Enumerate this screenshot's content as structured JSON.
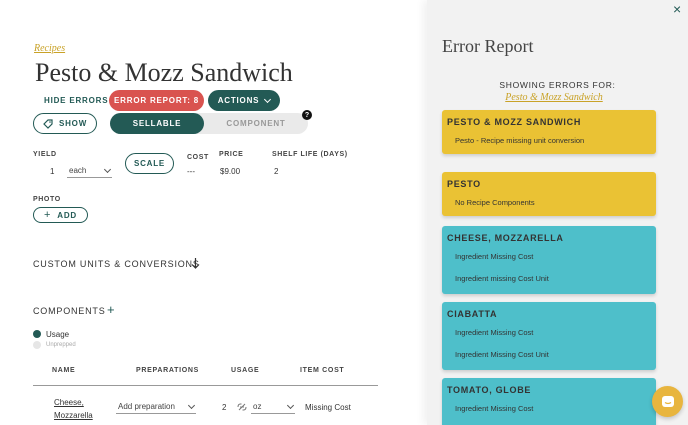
{
  "recipe": {
    "breadcrumb": "Recipes",
    "title": "Pesto & Mozz Sandwich"
  },
  "toolbar": {
    "hide_errors": "HIDE ERRORS",
    "error_report": "ERROR REPORT: 8",
    "actions": "ACTIONS",
    "show": "SHOW",
    "sellable": "SELLABLE",
    "component": "COMPONENT",
    "help": "?"
  },
  "details": {
    "yield_label": "YIELD",
    "yield_value": "1",
    "yield_unit": "each",
    "scale": "SCALE",
    "cost_label": "COST",
    "cost_value": "---",
    "price_label": "PRICE",
    "price_value": "$9.00",
    "shelf_label": "SHELF LIFE (DAYS)",
    "shelf_value": "2",
    "photo_label": "PHOTO",
    "add": "ADD"
  },
  "sections": {
    "custom_units": "CUSTOM UNITS & CONVERSIONS",
    "components": "COMPONENTS"
  },
  "legend": {
    "usage": "Usage",
    "unprepped": "Unprepped"
  },
  "table": {
    "headers": [
      "NAME",
      "PREPARATIONS",
      "USAGE",
      "ITEM COST"
    ],
    "row": {
      "name_line1": "Cheese,",
      "name_line2": "Mozzarella",
      "preparation": "Add preparation",
      "qty": "2",
      "unit": "oz",
      "cost": "Missing Cost"
    }
  },
  "panel": {
    "title": "Error Report",
    "showing": "SHOWING ERRORS FOR:",
    "recipe_link": "Pesto & Mozz Sandwich",
    "close": "×",
    "cards": [
      {
        "title": "PESTO & MOZZ SANDWICH",
        "lines": [
          "Pesto - Recipe missing unit conversion"
        ]
      },
      {
        "title": "PESTO",
        "lines": [
          "No Recipe Components"
        ]
      },
      {
        "title": "CHEESE, MOZZARELLA",
        "lines": [
          "Ingredient Missing Cost",
          "Ingredient missing Cost Unit"
        ]
      },
      {
        "title": "CIABATTA",
        "lines": [
          "Ingredient Missing Cost",
          "Ingredient Missing Cost Unit"
        ]
      },
      {
        "title": "TOMATO, GLOBE",
        "lines": [
          "Ingredient Missing Cost"
        ]
      }
    ]
  },
  "colors": {
    "teal_dark": "#235a55",
    "red": "#d9534f",
    "yellow": "#eac234",
    "teal_light": "#4ebfca",
    "gold_link": "#c9a227"
  }
}
